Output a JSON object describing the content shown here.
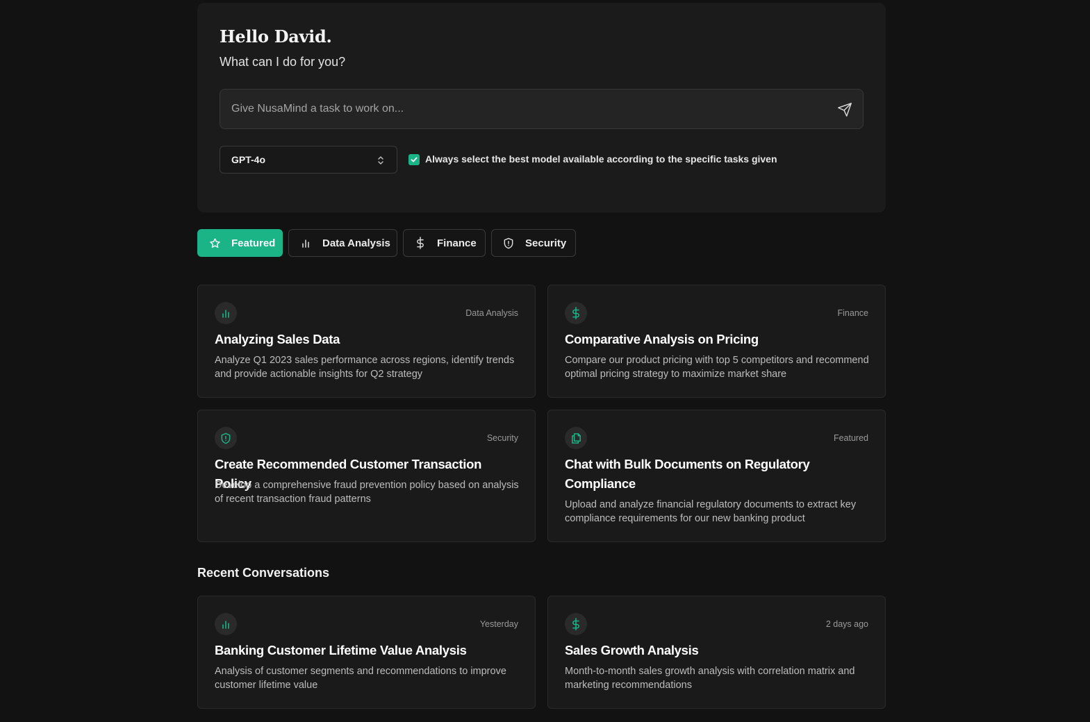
{
  "hero": {
    "greeting": "Hello David.",
    "subtitle": "What can I do for you?",
    "task_placeholder": "Give NusaMind a task to work on...",
    "model_value": "GPT-4o",
    "auto_select_label": "Always select the best model available according to the specific tasks given",
    "auto_select_checked": true
  },
  "tabs": [
    {
      "label": "Featured",
      "icon": "star-icon",
      "active": true
    },
    {
      "label": "Data Analysis",
      "icon": "bar-chart-icon",
      "active": false
    },
    {
      "label": "Finance",
      "icon": "dollar-icon",
      "active": false
    },
    {
      "label": "Security",
      "icon": "shield-icon",
      "active": false
    }
  ],
  "featured_cards": [
    {
      "icon": "bar-chart-icon",
      "tag": "Data Analysis",
      "title": "Analyzing Sales Data",
      "description": "Analyze Q1 2023 sales performance across regions, identify trends and provide actionable insights for Q2 strategy"
    },
    {
      "icon": "dollar-icon",
      "tag": "Finance",
      "title": "Comparative Analysis on Pricing",
      "description": "Compare our product pricing with top 5 competitors and recommend optimal pricing strategy to maximize market share"
    },
    {
      "icon": "shield-icon",
      "tag": "Security",
      "title": "Create Recommended Customer Transaction Policy",
      "description": "Develop a comprehensive fraud prevention policy based on analysis of recent transaction fraud patterns"
    },
    {
      "icon": "documents-icon",
      "tag": "Featured",
      "title": "Chat with Bulk Documents on Regulatory Compliance",
      "description": "Upload and analyze financial regulatory documents to extract key compliance requirements for our new banking product"
    }
  ],
  "recent": {
    "heading": "Recent Conversations",
    "items": [
      {
        "icon": "bar-chart-icon",
        "time": "Yesterday",
        "title": "Banking Customer Lifetime Value Analysis",
        "description": "Analysis of customer segments and recommendations to improve customer lifetime value"
      },
      {
        "icon": "dollar-icon",
        "time": "2 days ago",
        "title": "Sales Growth Analysis",
        "description": "Month-to-month sales growth analysis with correlation matrix and marketing recommendations"
      }
    ]
  },
  "colors": {
    "background": "#121212",
    "panel": "#1b1b1b",
    "accent": "#1bb487",
    "card": "#1a1a1a"
  }
}
